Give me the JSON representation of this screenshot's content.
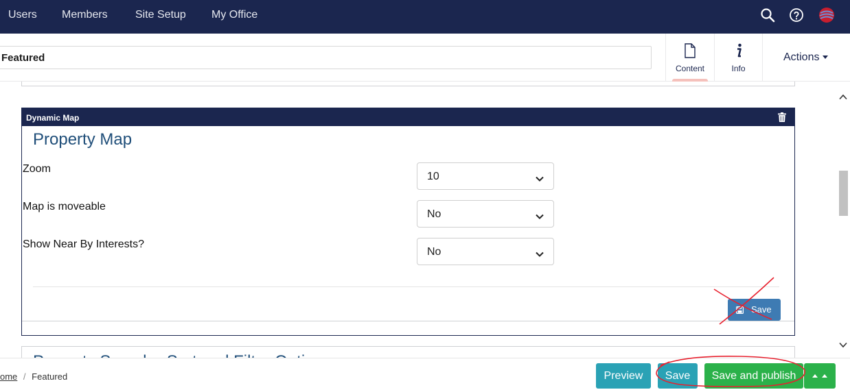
{
  "topnav": {
    "links": [
      "Users",
      "Members",
      "Site Setup",
      "My Office"
    ],
    "icons": [
      "search-icon",
      "help-icon",
      "user-avatar-icon"
    ]
  },
  "header": {
    "name_value": "Featured",
    "tabs": [
      {
        "label": "Content",
        "icon": "document-icon"
      },
      {
        "label": "Info",
        "icon": "info-icon"
      }
    ],
    "actions_label": "Actions"
  },
  "block": {
    "type_label": "Dynamic Map",
    "title": "Property Map",
    "fields": [
      {
        "label": "Zoom",
        "value": "10"
      },
      {
        "label": "Map is moveable",
        "value": "No"
      },
      {
        "label": "Show Near By Interests?",
        "value": "No"
      }
    ],
    "save_label": "Save"
  },
  "next_block": {
    "title": "Property Search - Sort and Filter Options"
  },
  "breadcrumb": {
    "items": [
      "ome",
      "Featured"
    ],
    "separator": "/"
  },
  "footer": {
    "preview_label": "Preview",
    "save_label": "Save",
    "publish_label": "Save and publish"
  },
  "colors": {
    "navy": "#1b264f",
    "teal_button": "#2aa2b5",
    "green_button": "#2bb14a",
    "block_save": "#3e7bb3",
    "annotation_red": "#e8202e"
  }
}
